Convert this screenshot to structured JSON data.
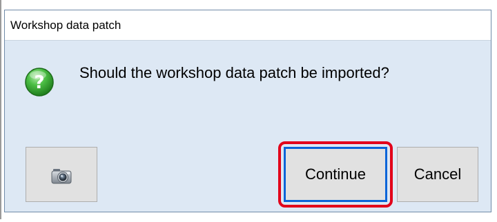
{
  "dialog": {
    "title": "Workshop data patch",
    "message": "Should the workshop data patch be imported?",
    "icon": "question-icon",
    "buttons": {
      "screenshot_icon": "camera-icon",
      "continue_label": "Continue",
      "cancel_label": "Cancel"
    }
  },
  "colors": {
    "dialog_background": "#dde8f4",
    "default_button_border": "#0a64d8",
    "highlight": "#e2001a",
    "question_icon_green": "#3aa636"
  }
}
